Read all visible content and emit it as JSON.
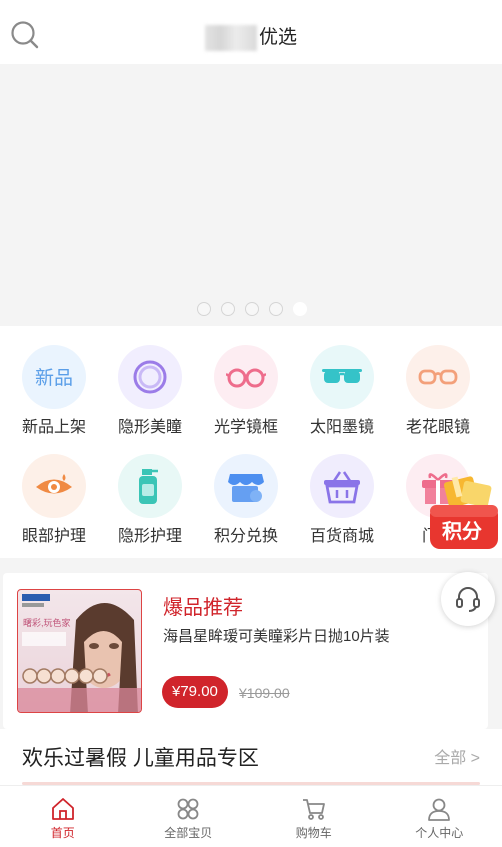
{
  "header": {
    "title_visible": "优选",
    "search_icon": "search-icon"
  },
  "banner": {
    "slide_count": 5,
    "active_index": 4
  },
  "categories": [
    {
      "label": "新品上架",
      "icon": "new-product-icon",
      "badge_text": "新品",
      "color": "#5a9ee8",
      "bg": "#eaf4fe"
    },
    {
      "label": "隐形美瞳",
      "icon": "contact-lens-icon",
      "color": "#9b7ce8",
      "bg": "#f1eefe"
    },
    {
      "label": "光学镜框",
      "icon": "glasses-frame-icon",
      "color": "#ee6d8c",
      "bg": "#fdedf2"
    },
    {
      "label": "太阳墨镜",
      "icon": "sunglasses-icon",
      "color": "#35c3c8",
      "bg": "#e8f8f9"
    },
    {
      "label": "老花眼镜",
      "icon": "reading-glasses-icon",
      "color": "#f3a07a",
      "bg": "#fdf0ea"
    },
    {
      "label": "眼部护理",
      "icon": "eye-care-icon",
      "color": "#f08a43",
      "bg": "#fdf0e8"
    },
    {
      "label": "隐形护理",
      "icon": "lens-solution-icon",
      "color": "#3bc5b6",
      "bg": "#e8f8f6"
    },
    {
      "label": "积分兑换",
      "icon": "points-shop-icon",
      "color": "#4d8ff0",
      "bg": "#ebf3fe"
    },
    {
      "label": "百货商城",
      "icon": "shopping-basket-icon",
      "color": "#8a74e8",
      "bg": "#f0edfd"
    },
    {
      "label": "门店",
      "icon": "gift-icon",
      "color": "#ee6d8c",
      "bg": "#fdedf2"
    }
  ],
  "points_float": {
    "label": "积分"
  },
  "product": {
    "section_label": "爆品推荐",
    "name": "海昌星眸瑷可美瞳彩片日抛10片装",
    "price": "¥79.00",
    "original_price": "¥109.00",
    "image_caption": "曙彩,玩色家"
  },
  "section": {
    "title": "欢乐过暑假 儿童用品专区",
    "more_label": "全部 >"
  },
  "tabs": [
    {
      "label": "首页",
      "icon": "home-icon",
      "active": true
    },
    {
      "label": "全部宝贝",
      "icon": "grid-icon",
      "active": false
    },
    {
      "label": "购物车",
      "icon": "cart-icon",
      "active": false
    },
    {
      "label": "个人中心",
      "icon": "user-icon",
      "active": false
    }
  ],
  "colors": {
    "accent": "#d0242b",
    "page_bg": "#f4f4f4"
  }
}
